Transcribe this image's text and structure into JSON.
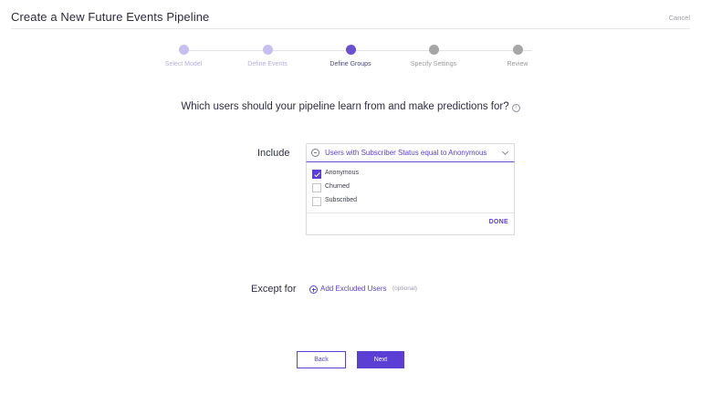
{
  "header": {
    "title": "Create a New Future Events Pipeline",
    "cancel_label": "Cancel"
  },
  "stepper": {
    "steps": [
      {
        "label": "Select Model",
        "status": "done"
      },
      {
        "label": "Define Events",
        "status": "done"
      },
      {
        "label": "Define Groups",
        "status": "active"
      },
      {
        "label": "Specify Settings",
        "status": "todo"
      },
      {
        "label": "Review",
        "status": "todo"
      }
    ],
    "colors": {
      "done": "#c7bff0",
      "active": "#6a4fd0",
      "todo": "#a6a6a6"
    }
  },
  "question": {
    "text": "Which users should your pipeline learn from and make predictions for?",
    "icon": "info-icon"
  },
  "include": {
    "label": "Include",
    "select_value": "Users with Subscriber Status equal to Anonymous",
    "options": [
      {
        "label": "Anonymous",
        "checked": true
      },
      {
        "label": "Churned",
        "checked": false
      },
      {
        "label": "Subscribed",
        "checked": false
      }
    ],
    "done_label": "DONE"
  },
  "except": {
    "label": "Except for",
    "add_label": "Add Excluded Users",
    "optional_label": "(optional)"
  },
  "footer": {
    "back_label": "Back",
    "next_label": "Next"
  },
  "theme": {
    "accent": "#5b3fd4"
  }
}
